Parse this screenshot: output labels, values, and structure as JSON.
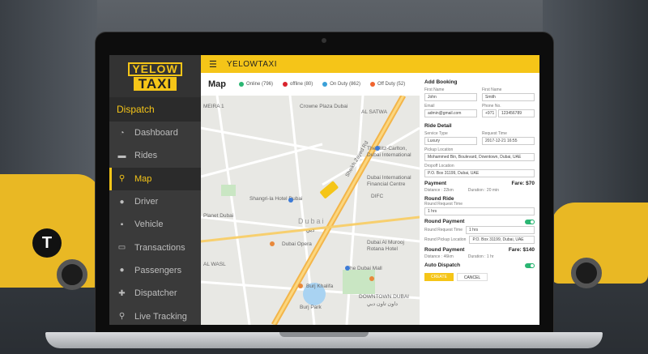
{
  "brand": {
    "logo_top": "YELOW",
    "logo_bottom": "TAXI",
    "accent": "#f5c518"
  },
  "sidebar": {
    "section": "Dispatch",
    "items": [
      {
        "label": "Dashboard",
        "icon": "dashboard-icon"
      },
      {
        "label": "Rides",
        "icon": "car-icon"
      },
      {
        "label": "Map",
        "icon": "map-pin-icon",
        "active": true
      },
      {
        "label": "Driver",
        "icon": "user-icon"
      },
      {
        "label": "Vehicle",
        "icon": "vehicle-icon"
      },
      {
        "label": "Transactions",
        "icon": "money-icon"
      },
      {
        "label": "Passengers",
        "icon": "users-icon"
      },
      {
        "label": "Dispatcher",
        "icon": "user-plus-icon"
      },
      {
        "label": "Live Tracking",
        "icon": "location-icon"
      }
    ]
  },
  "header": {
    "title": "YELOWTAXI"
  },
  "map": {
    "title": "Map",
    "legend": [
      {
        "label": "Online (796)",
        "color": "#2bb673"
      },
      {
        "label": "offline (80)",
        "color": "#d9232d"
      },
      {
        "label": "On Duty (862)",
        "color": "#3aa0d8"
      },
      {
        "label": "Off Duty (52)",
        "color": "#f0642e"
      }
    ],
    "labels": {
      "crowne": "Crowne Plaza Dubai",
      "satwa": "AL SATWA",
      "meira": "MEIRA 1",
      "ritz": "The Ritz-Carlton,",
      "ritz2": "Dubai International",
      "difc_tower": "Dubai International",
      "difc_tower2": "Financial Centre",
      "shangri": "Shangri-la Hotel Dubai",
      "difc": "DIFC",
      "planet": "Planet Dubai",
      "dubai": "Dubai",
      "dubai_ar": "دبي",
      "opera": "Dubai Opera",
      "almurooj": "Dubai Al Murooj",
      "rotana": "Rotana Hotel",
      "wasl": "AL WASL",
      "mall": "The Dubai Mall",
      "khalifa": "Burj Khalifa",
      "downtown": "DOWNTOWN DUBAI",
      "downtown_ar": "داون تاون دبي",
      "burjpark": "Burj Park",
      "road": "Sheikh Zayed Rd",
      "r1": "D90",
      "r2": "D94",
      "r3": "D90",
      "r4": "D71",
      "r5": "D61",
      "r6": "D71",
      "r7": "E11",
      "r8": "E44",
      "r9": "D61"
    }
  },
  "form": {
    "add_booking": "Add Booking",
    "first_name_label": "First Name",
    "first_name": "John",
    "last_name_label": "First Name",
    "last_name": "Smith",
    "email_label": "Email",
    "email": "admin@gmail.com",
    "phone_label": "Phone No.",
    "phone_code": "+971",
    "phone": "123456789",
    "ride_detail": "Ride Detail",
    "service_type_label": "Service Type",
    "service_type": "Luxury",
    "request_time_label": "Request Time",
    "request_time": "2017-12-21 16:55",
    "pickup_label": "Pickup Location",
    "pickup": "Mohammed Bin, Boulevard, Downtown, Dubai, UAE",
    "dropoff_label": "Dropoff Location",
    "dropoff": "P.O. Box 31199, Dubai, UAE",
    "payment": "Payment",
    "fare1": "Fare: $70",
    "distance1": "Distance : 22km",
    "duration1": "Duration : 20 min",
    "round_ride": "Round Ride",
    "round_request_label": "Round Request Time",
    "round_hours": "1 hrs",
    "round_payment": "Round Payment",
    "rrt_label": "Round Request Time",
    "rrt_value": "1 hrs",
    "rpl_label": "Round Pickup Location",
    "rpl_value": "P.O. Box 31199, Dubai, UAE",
    "round_payment2": "Round Payment",
    "fare2": "Fare: $140",
    "distance2": "Distance : 46km",
    "duration2": "Duration : 1 hr",
    "auto_dispatch": "Auto Dispatch",
    "create": "CREATE",
    "cancel": "CANCEL"
  }
}
